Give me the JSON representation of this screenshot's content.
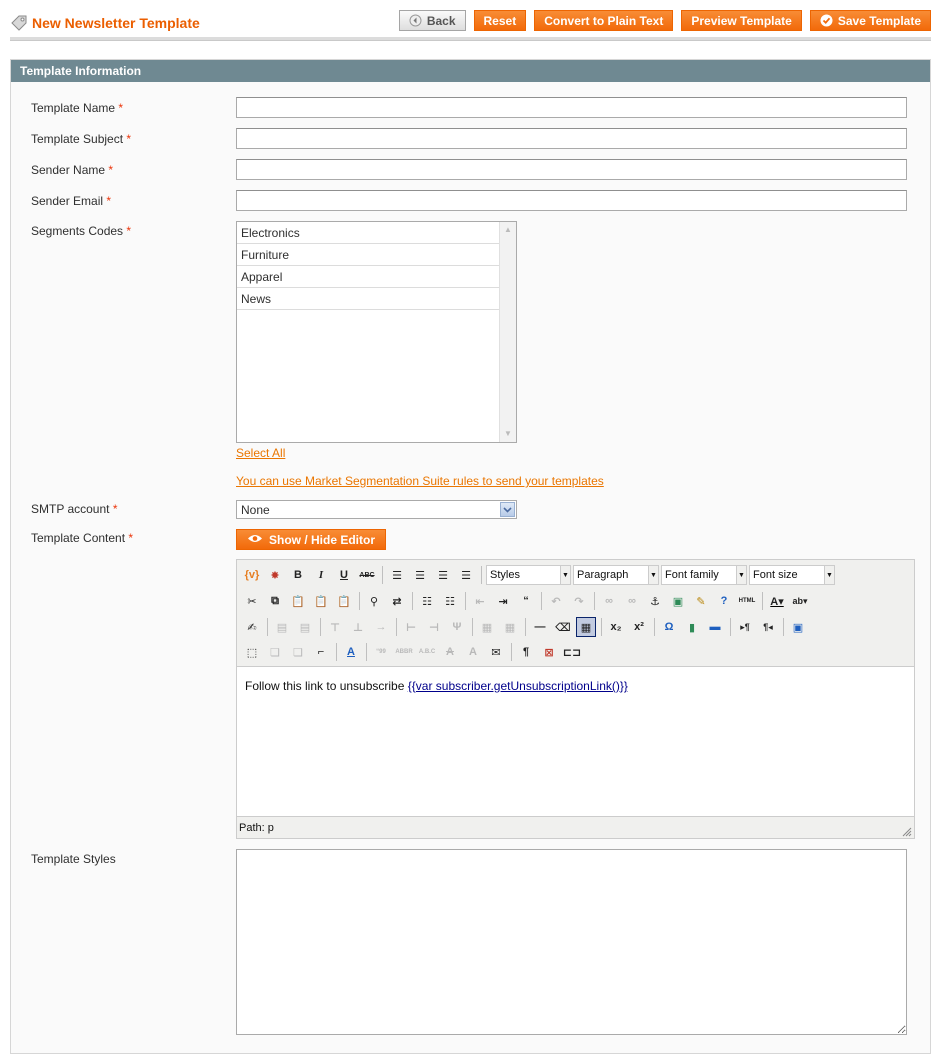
{
  "header": {
    "title": "New Newsletter Template",
    "buttons": {
      "back": "Back",
      "reset": "Reset",
      "convert": "Convert to Plain Text",
      "preview": "Preview Template",
      "save": "Save Template"
    }
  },
  "section": {
    "title": "Template Information"
  },
  "form": {
    "template_name": {
      "label": "Template Name",
      "value": ""
    },
    "template_subject": {
      "label": "Template Subject",
      "value": ""
    },
    "sender_name": {
      "label": "Sender Name",
      "value": ""
    },
    "sender_email": {
      "label": "Sender Email",
      "value": ""
    },
    "segments": {
      "label": "Segments Codes",
      "options": [
        "Electronics",
        "Furniture",
        "Apparel",
        "News"
      ],
      "select_all": "Select All",
      "note": "You can use Market Segmentation Suite rules to send your templates"
    },
    "smtp": {
      "label": "SMTP account",
      "value": "None"
    },
    "content": {
      "label": "Template Content",
      "toggle_button": "Show / Hide Editor",
      "toolbar": {
        "styles": "Styles",
        "format": "Paragraph",
        "font_family": "Font family",
        "font_size": "Font size"
      },
      "text_prefix": "Follow this link to unsubscribe ",
      "text_var": "{{var subscriber.getUnsubscriptionLink()}}",
      "path": "Path: p"
    },
    "styles": {
      "label": "Template Styles",
      "value": ""
    }
  },
  "colors": {
    "accent": "#eb5e00",
    "section_header": "#6f8992",
    "button": "#f26a0a"
  }
}
